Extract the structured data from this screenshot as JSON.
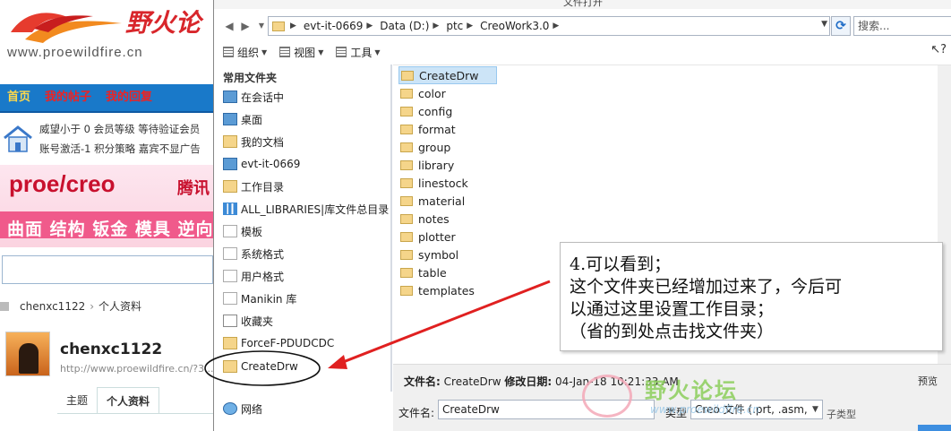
{
  "site": {
    "logo_text": "野火论",
    "logo_url": "www.proewildfire.cn",
    "nav": [
      "首页",
      "我的帖子",
      "我的回复"
    ],
    "user_line1": "威望小于 0  会员等级   等待验证会员",
    "user_line2": "账号激活-1  积分策略   嘉宾不显广告",
    "banner_title": "proe/creo",
    "banner_tag": "腾讯",
    "banner_sub": "曲面 结构 钣金 模具 逆向",
    "breadcrumb": [
      "chenxc1122",
      "个人资料"
    ],
    "profile_name": "chenxc1122",
    "profile_url": "http://www.proewildfire.cn/?3...",
    "profile_tabs": [
      "主题",
      "个人资料"
    ]
  },
  "dialog": {
    "title": "文件打开",
    "address": [
      "evt-it-0669",
      "Data (D:)",
      "ptc",
      "CreoWork3.0"
    ],
    "search_placeholder": "搜索...",
    "toolbar": [
      "组织",
      "视图",
      "工具"
    ],
    "nav_header": "常用文件夹",
    "nav_items": [
      {
        "label": "在会话中",
        "icon": "computer-icon"
      },
      {
        "label": "桌面",
        "icon": "desktop-icon"
      },
      {
        "label": "我的文档",
        "icon": "documents-icon"
      },
      {
        "label": "evt-it-0669",
        "icon": "computer-icon"
      },
      {
        "label": "工作目录",
        "icon": "working-directory-icon"
      },
      {
        "label": "ALL_LIBRARIES|库文件总目录",
        "icon": "library-icon"
      },
      {
        "label": "模板",
        "icon": "folder-icon"
      },
      {
        "label": "系统格式",
        "icon": "folder-icon"
      },
      {
        "label": "用户格式",
        "icon": "folder-icon"
      },
      {
        "label": "Manikin 库",
        "icon": "folder-icon"
      },
      {
        "label": "收藏夹",
        "icon": "favorites-icon"
      },
      {
        "label": "ForceF-PDUDCDC",
        "icon": "folder-icon"
      },
      {
        "label": "CreateDrw",
        "icon": "folder-icon"
      },
      {
        "label": "网络",
        "icon": "network-icon"
      }
    ],
    "files": [
      "CreateDrw",
      "color",
      "config",
      "format",
      "group",
      "library",
      "linestock",
      "material",
      "notes",
      "plotter",
      "symbol",
      "table",
      "templates"
    ],
    "selected_file": "CreateDrw",
    "details_name_label": "文件名:",
    "details_name": "CreateDrw",
    "details_date_label": "修改日期:",
    "details_date": "04-Jan-18 10:21:33 AM",
    "preview_label": "预览",
    "filename_label": "文件名:",
    "filename_value": "CreateDrw",
    "type_label": "类型",
    "type_value": "Creo 文件 (.prt, .asm,",
    "type_sub": "子类型"
  },
  "watermark": {
    "text": "野火论坛",
    "url": "www.proewildfire.cn"
  },
  "annotation": {
    "lines": [
      "4.可以看到；",
      "这个文件夹已经增加过来了，今后可",
      "以通过这里设置工作目录；",
      "（省的到处点击找文件夹）"
    ],
    "arrow_color": "#e02020"
  }
}
